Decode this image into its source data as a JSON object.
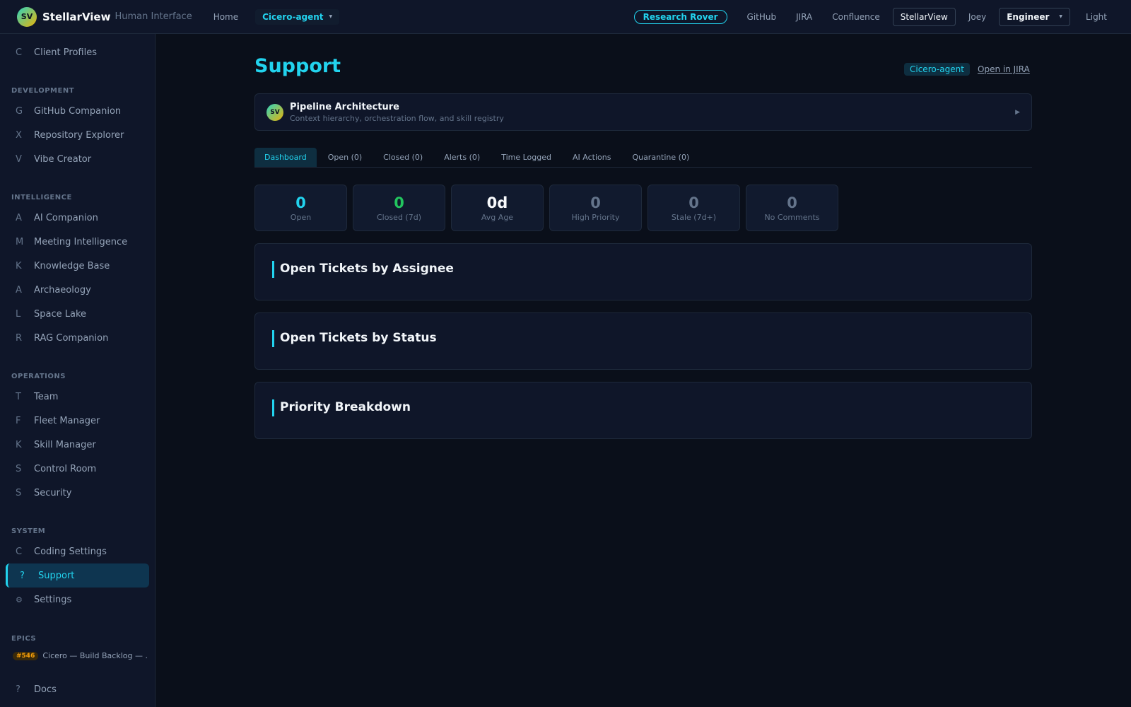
{
  "header": {
    "logo_text": "SV",
    "brand": "StellarView",
    "brand_sub": "Human Interface",
    "home": "Home",
    "agent": "Cicero-agent",
    "research": "Research Rover",
    "links": [
      "GitHub",
      "JIRA",
      "Confluence"
    ],
    "active_app": "StellarView",
    "user": "Joey",
    "role": "Engineer",
    "theme": "Light"
  },
  "sidebar": {
    "top_item": {
      "icon": "C",
      "label": "Client Profiles"
    },
    "sections": {
      "development": "DEVELOPMENT",
      "intelligence": "INTELLIGENCE",
      "operations": "OPERATIONS",
      "system": "SYSTEM",
      "epics": "EPICS"
    },
    "development": [
      {
        "icon": "G",
        "label": "GitHub Companion"
      },
      {
        "icon": "X",
        "label": "Repository Explorer"
      },
      {
        "icon": "V",
        "label": "Vibe Creator"
      }
    ],
    "intelligence": [
      {
        "icon": "A",
        "label": "AI Companion"
      },
      {
        "icon": "M",
        "label": "Meeting Intelligence"
      },
      {
        "icon": "K",
        "label": "Knowledge Base"
      },
      {
        "icon": "A",
        "label": "Archaeology"
      },
      {
        "icon": "L",
        "label": "Space Lake"
      },
      {
        "icon": "R",
        "label": "RAG Companion"
      }
    ],
    "operations": [
      {
        "icon": "T",
        "label": "Team"
      },
      {
        "icon": "F",
        "label": "Fleet Manager"
      },
      {
        "icon": "K",
        "label": "Skill Manager"
      },
      {
        "icon": "S",
        "label": "Control Room"
      },
      {
        "icon": "S",
        "label": "Security"
      }
    ],
    "system": [
      {
        "icon": "C",
        "label": "Coding Settings"
      },
      {
        "icon": "?",
        "label": "Support"
      },
      {
        "icon": "⚙",
        "label": "Settings"
      }
    ],
    "epic": {
      "badge": "#546",
      "label": "Cicero — Build Backlog — ..."
    },
    "docs": {
      "icon": "?",
      "label": "Docs"
    }
  },
  "main": {
    "title": "Support",
    "title_tag": "Cicero-agent",
    "title_link": "Open in JIRA",
    "pipeline": {
      "logo_text": "SV",
      "title": "Pipeline Architecture",
      "subtitle": "Context hierarchy, orchestration flow, and skill registry",
      "play_icon": "▶"
    },
    "tabs": [
      "Dashboard",
      "Open (0)",
      "Closed (0)",
      "Alerts (0)",
      "Time Logged",
      "AI Actions",
      "Quarantine (0)"
    ],
    "stats": [
      {
        "value": "0",
        "label": "Open",
        "color": "#22d3ee"
      },
      {
        "value": "0",
        "label": "Closed (7d)",
        "color": "#22c55e"
      },
      {
        "value": "0d",
        "label": "Avg Age",
        "color": "#f8fafc"
      },
      {
        "value": "0",
        "label": "High Priority",
        "color": "#64748b"
      },
      {
        "value": "0",
        "label": "Stale (7d+)",
        "color": "#64748b"
      },
      {
        "value": "0",
        "label": "No Comments",
        "color": "#64748b"
      }
    ],
    "cards": [
      "Open Tickets by Assignee",
      "Open Tickets by Status",
      "Priority Breakdown"
    ]
  },
  "colors": {
    "accent": "#22d3ee",
    "success": "#22c55e",
    "warning": "#f59e0b"
  }
}
